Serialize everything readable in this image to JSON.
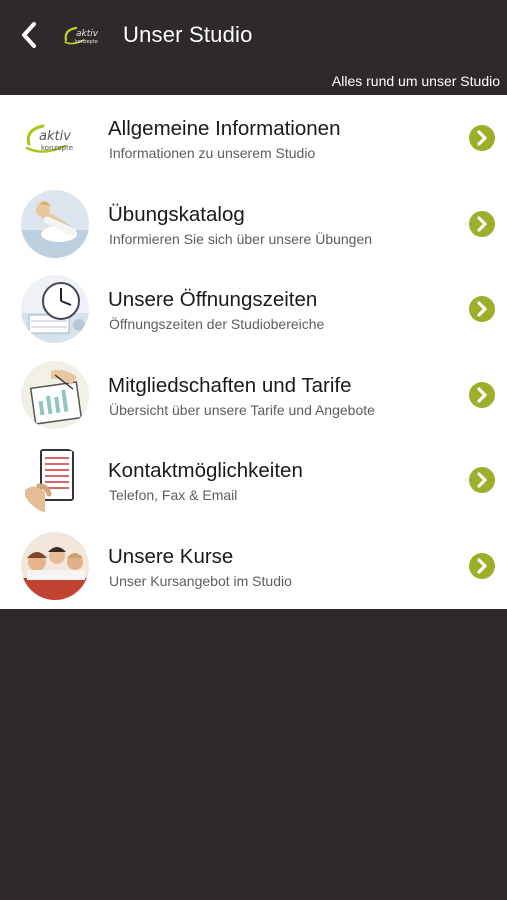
{
  "header": {
    "title": "Unser Studio",
    "subtitle": "Alles rund um unser Studio",
    "logo_text_top": "aktiv",
    "logo_text_bottom": "konzepte"
  },
  "colors": {
    "background": "#2d2a29",
    "list_background": "#ffffff",
    "accent_green": "#9cae2a",
    "title_text": "#1a1a1a",
    "subtitle_text": "#5d5d5d"
  },
  "items": [
    {
      "title": "Allgemeine Informationen",
      "subtitle": "Informationen zu unserem Studio",
      "icon": "aktiv-konzepte-logo"
    },
    {
      "title": "Übungskatalog",
      "subtitle": "Informieren Sie sich über unsere Übungen",
      "icon": "exercise-photo"
    },
    {
      "title": "Unsere Öffnungszeiten",
      "subtitle": "Öffnungszeiten der Studiobereiche",
      "icon": "clock-photo"
    },
    {
      "title": "Mitgliedschaften und Tarife",
      "subtitle": "Übersicht über unsere Tarife und Angebote",
      "icon": "tariff-chart-photo"
    },
    {
      "title": "Kontaktmöglichkeiten",
      "subtitle": "Telefon, Fax & Email",
      "icon": "contact-card-photo"
    },
    {
      "title": "Unsere Kurse",
      "subtitle": "Unser Kursangebot im Studio",
      "icon": "course-group-photo"
    }
  ]
}
